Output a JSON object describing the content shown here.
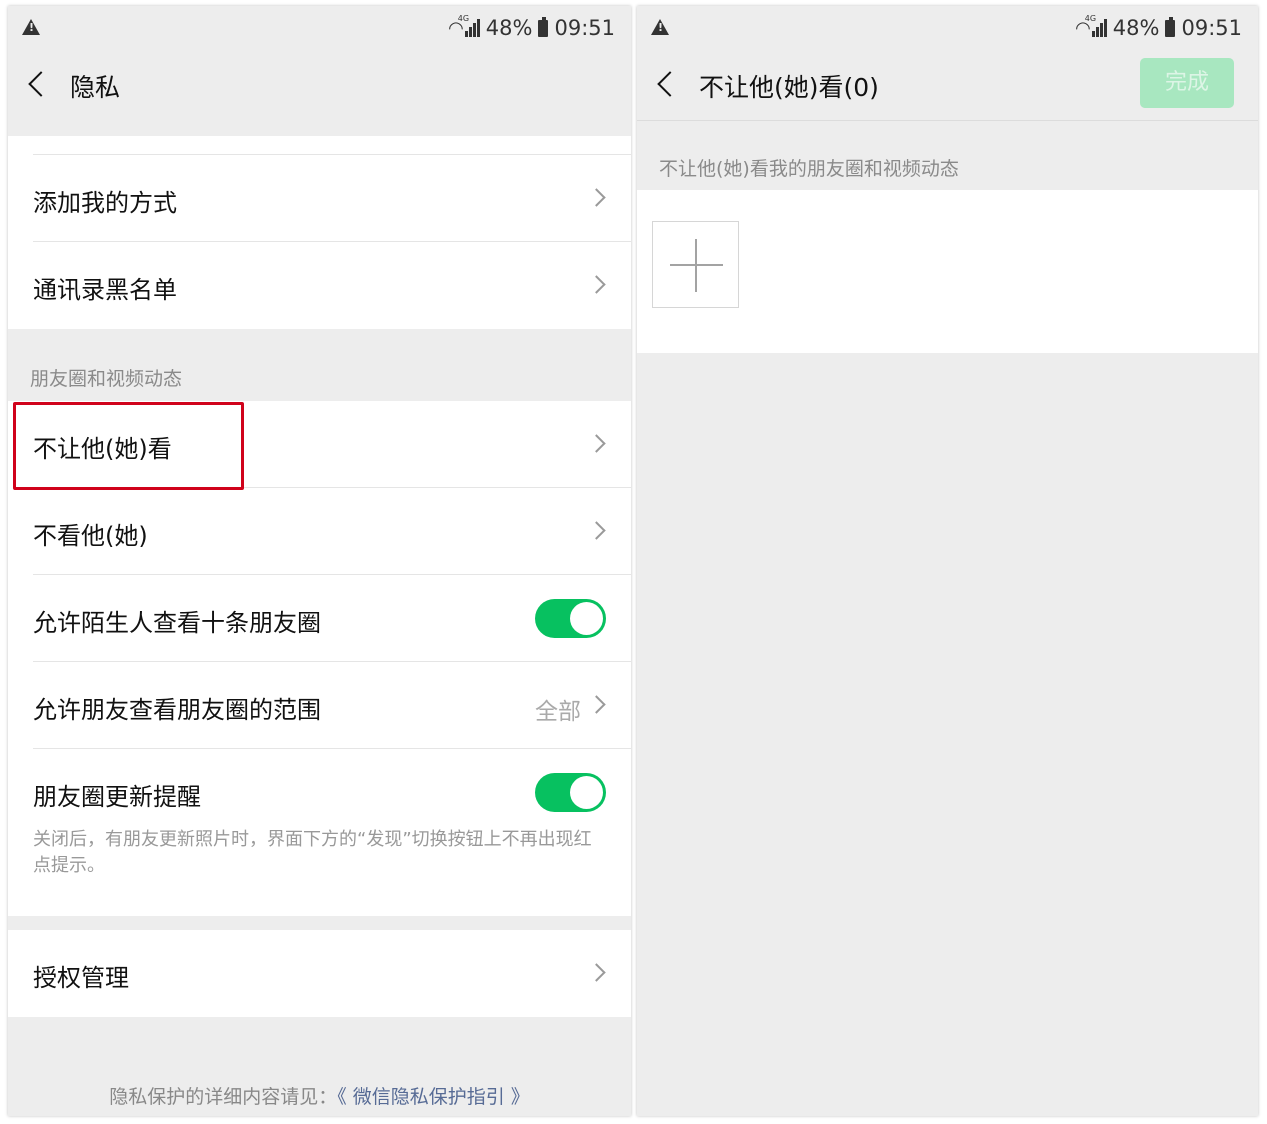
{
  "status_bar": {
    "battery": "48%",
    "time": "09:51"
  },
  "left": {
    "title": "隐私",
    "rows_top": [
      {
        "label": "添加我的方式"
      },
      {
        "label": "通讯录黑名单"
      }
    ],
    "moments_section_label": "朋友圈和视频动态",
    "moments_rows": [
      {
        "label": "不让他(她)看"
      },
      {
        "label": "不看他(她)"
      },
      {
        "label": "允许陌生人查看十条朋友圈",
        "toggle_on": true
      },
      {
        "label": "允许朋友查看朋友圈的范围",
        "value": "全部"
      },
      {
        "label": "朋友圈更新提醒",
        "toggle_on": true,
        "note": "关闭后，有朋友更新照片时，界面下方的“发现”切换按钮上不再出现红点提示。"
      }
    ],
    "auth_row": {
      "label": "授权管理"
    },
    "footer_text": "隐私保护的详细内容请见：",
    "footer_link": "《 微信隐私保护指引 》"
  },
  "right": {
    "title": "不让他(她)看(0)",
    "done_label": "完成",
    "section_label": "不让他(她)看我的朋友圈和视频动态"
  },
  "colors": {
    "accent_green": "#07c160",
    "highlight_red": "#d0021b",
    "link_blue": "#576b95"
  }
}
